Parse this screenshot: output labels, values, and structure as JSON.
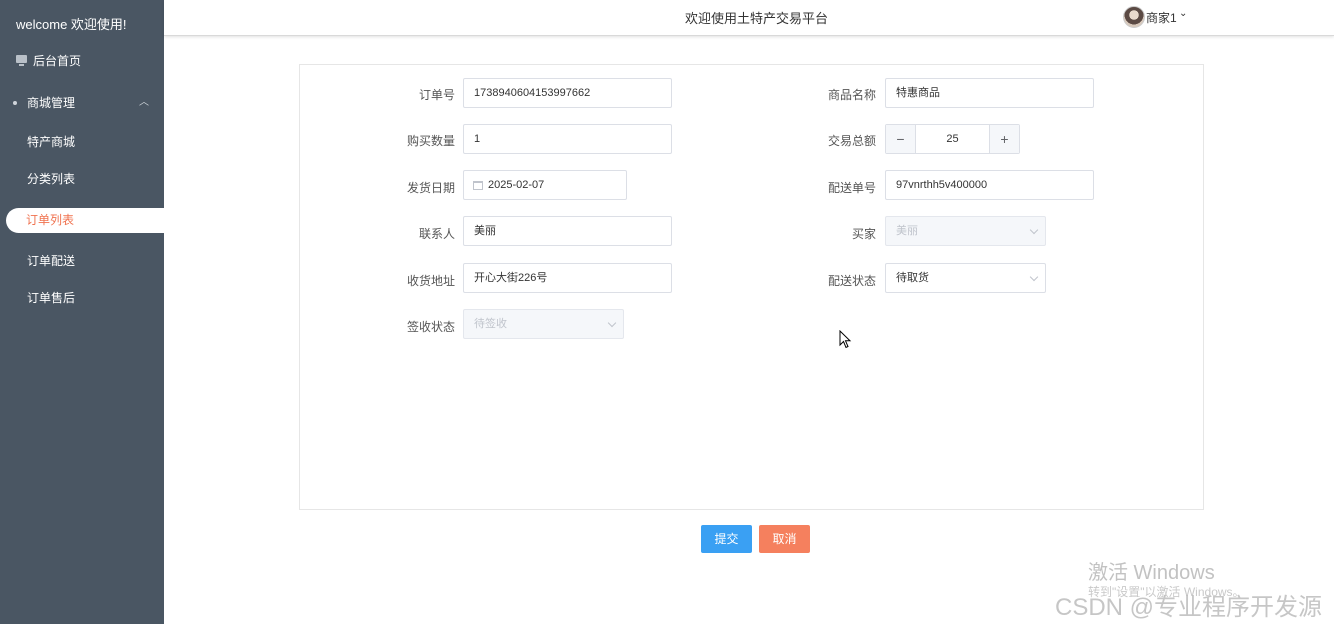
{
  "sidebar": {
    "welcome": "welcome 欢迎使用!",
    "home_label": "后台首页",
    "group_label": "商城管理",
    "items": [
      {
        "label": "特产商城"
      },
      {
        "label": "分类列表"
      },
      {
        "label": "订单列表"
      },
      {
        "label": "订单配送"
      },
      {
        "label": "订单售后"
      }
    ],
    "active_index": 2
  },
  "header": {
    "title": "欢迎使用土特产交易平台",
    "user_name": "商家1"
  },
  "form": {
    "order_no": {
      "label": "订单号",
      "value": "1738940604153997662"
    },
    "product_name": {
      "label": "商品名称",
      "value": "特惠商品"
    },
    "quantity": {
      "label": "购买数量",
      "value": "1"
    },
    "total": {
      "label": "交易总额",
      "value": "25",
      "minus": "−",
      "plus": "+"
    },
    "ship_date": {
      "label": "发货日期",
      "value": "2025-02-07"
    },
    "delivery_no": {
      "label": "配送单号",
      "value": "97vnrthh5v400000"
    },
    "contact": {
      "label": "联系人",
      "value": "美丽"
    },
    "buyer": {
      "label": "买家",
      "value": "美丽"
    },
    "address": {
      "label": "收货地址",
      "value": "开心大街226号"
    },
    "delivery_status": {
      "label": "配送状态",
      "value": "待取货"
    },
    "receipt_status": {
      "label": "签收状态",
      "value": "待签收"
    }
  },
  "actions": {
    "submit": "提交",
    "cancel": "取消"
  },
  "watermark": {
    "activate_title": "激活 Windows",
    "activate_sub": "转到\"设置\"以激活 Windows。",
    "csdn": "CSDN @专业程序开发源"
  },
  "colors": {
    "sidebar_bg": "#4a5663",
    "active_text": "#f0724f",
    "submit_bg": "#3aa0f3",
    "cancel_bg": "#f5805e"
  }
}
